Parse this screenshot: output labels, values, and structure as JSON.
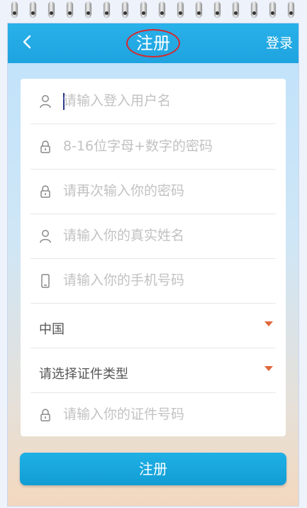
{
  "header": {
    "title": "注册",
    "login_label": "登录",
    "back_icon": "chevron-left-icon",
    "title_highlight_color": "#d8282c"
  },
  "form": {
    "fields": [
      {
        "placeholder": "请输入登入用户名",
        "icon": "user-icon",
        "focused": true
      },
      {
        "placeholder": "8-16位字母+数字的密码",
        "icon": "lock-icon"
      },
      {
        "placeholder": "请再次输入你的密码",
        "icon": "lock-icon"
      },
      {
        "placeholder": "请输入你的真实姓名",
        "icon": "user-icon"
      },
      {
        "placeholder": "请输入你的手机号码",
        "icon": "phone-icon"
      }
    ],
    "country_select": {
      "value": "中国",
      "icon": "caret-down-icon"
    },
    "id_type_select": {
      "value": "请选择证件类型",
      "icon": "caret-down-icon"
    },
    "id_number_field": {
      "placeholder": "请输入你的证件号码",
      "icon": "lock-icon"
    }
  },
  "submit_label": "注册",
  "colors": {
    "header": "#1ea3df",
    "button": "#129dd4",
    "caret": "#e0663a",
    "placeholder": "#c2c2c2"
  }
}
